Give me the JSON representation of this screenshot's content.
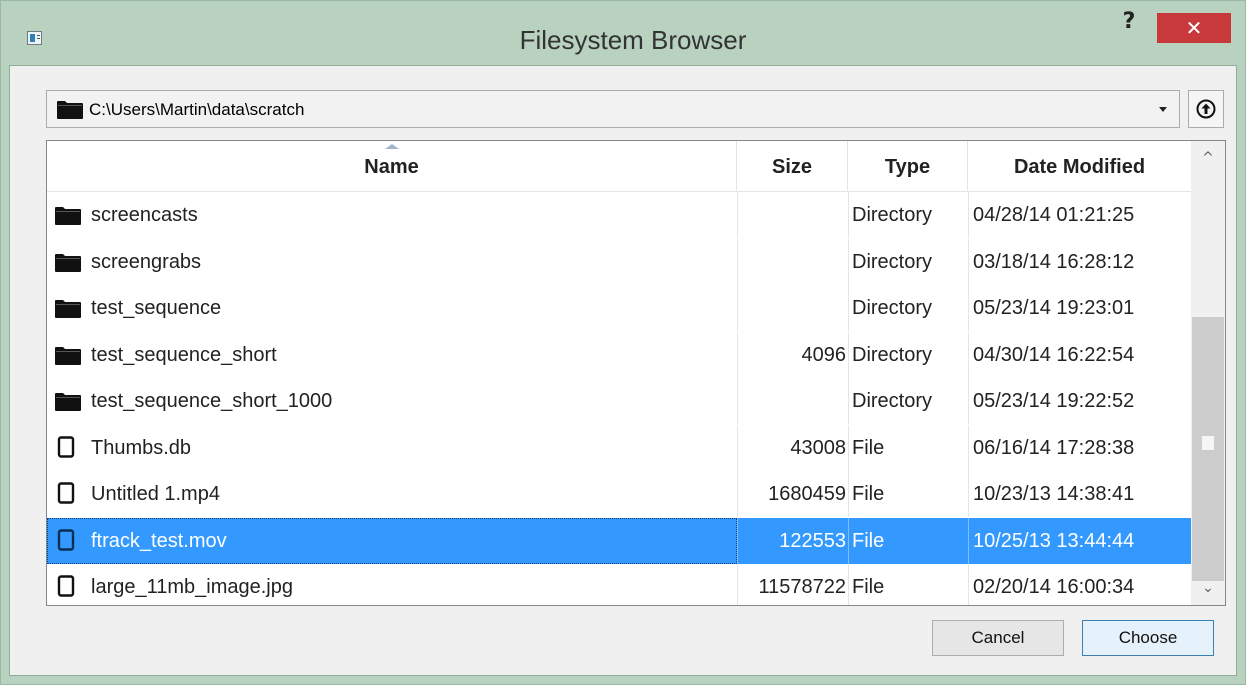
{
  "window": {
    "title": "Filesystem Browser",
    "help_label": "?",
    "close_label": "✕"
  },
  "path_bar": {
    "current_path": "C:\\Users\\Martin\\data\\scratch"
  },
  "table": {
    "columns": [
      "Name",
      "Size",
      "Type",
      "Date Modified"
    ],
    "rows": [
      {
        "icon": "folder-icon",
        "name": "screencasts",
        "size": "",
        "type": "Directory",
        "date": "04/28/14 01:21:25"
      },
      {
        "icon": "folder-icon",
        "name": "screengrabs",
        "size": "",
        "type": "Directory",
        "date": "03/18/14 16:28:12"
      },
      {
        "icon": "folder-icon",
        "name": "test_sequence",
        "size": "",
        "type": "Directory",
        "date": "05/23/14 19:23:01"
      },
      {
        "icon": "folder-icon",
        "name": "test_sequence_short",
        "size": "4096",
        "type": "Directory",
        "date": "04/30/14 16:22:54"
      },
      {
        "icon": "folder-icon",
        "name": "test_sequence_short_1000",
        "size": "",
        "type": "Directory",
        "date": "05/23/14 19:22:52"
      },
      {
        "icon": "file-icon",
        "name": "Thumbs.db",
        "size": "43008",
        "type": "File",
        "date": "06/16/14 17:28:38"
      },
      {
        "icon": "file-icon",
        "name": "Untitled 1.mp4",
        "size": "1680459",
        "type": "File",
        "date": "10/23/13 14:38:41"
      },
      {
        "icon": "file-icon",
        "name": "ftrack_test.mov",
        "size": "122553",
        "type": "File",
        "date": "10/25/13 13:44:44",
        "selected": true
      },
      {
        "icon": "file-icon",
        "name": "large_11mb_image.jpg",
        "size": "11578722",
        "type": "File",
        "date": "02/20/14 16:00:34"
      }
    ]
  },
  "buttons": {
    "cancel_label": "Cancel",
    "choose_label": "Choose"
  },
  "colors": {
    "selection": "#3399ff",
    "close_button": "#c7393a",
    "frame": "#b9d2c0"
  }
}
